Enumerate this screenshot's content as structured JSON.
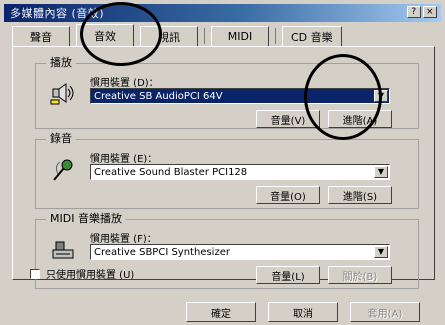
{
  "window": {
    "title": "多媒體內容 (音效)",
    "controls": [
      "?",
      "×"
    ]
  },
  "tabs": [
    {
      "label": "聲音",
      "active": false
    },
    {
      "label": "音效",
      "active": true
    },
    {
      "label": "視訊",
      "active": false
    },
    {
      "label": "MIDI",
      "active": false
    },
    {
      "label": "CD 音樂",
      "active": false
    }
  ],
  "groups": {
    "playback": {
      "title": "播放",
      "label": "慣用裝置 (D)：",
      "device": "Creative SB AudioPCI 64V",
      "buttons": {
        "volume": "音量(V)",
        "advanced": "進階(A)"
      },
      "selected": true
    },
    "recording": {
      "title": "錄音",
      "label": "慣用裝置 (E)：",
      "device": "Creative Sound Blaster PCI128",
      "buttons": {
        "volume": "音量(O)",
        "advanced": "進階(S)"
      }
    },
    "midi": {
      "title": "MIDI 音樂播放",
      "label": "慣用裝置 (F)：",
      "device": "Creative SBPCI Synthesizer",
      "buttons": {
        "volume": "音量(L)",
        "about": "關於(B)"
      }
    }
  },
  "checkbox": {
    "label": "只使用慣用裝置 (U)",
    "checked": false
  },
  "footer": {
    "ok": "確定",
    "cancel": "取消",
    "apply": "套用(A)"
  },
  "colors": {
    "face": "#d4d0c8",
    "title_start": "#0a246a",
    "selected_bg": "#0a246a",
    "annotation_ink": "#000000"
  },
  "icons": {
    "playback": "speaker-icon",
    "recording": "microphone-icon",
    "midi": "midi-device-icon"
  }
}
